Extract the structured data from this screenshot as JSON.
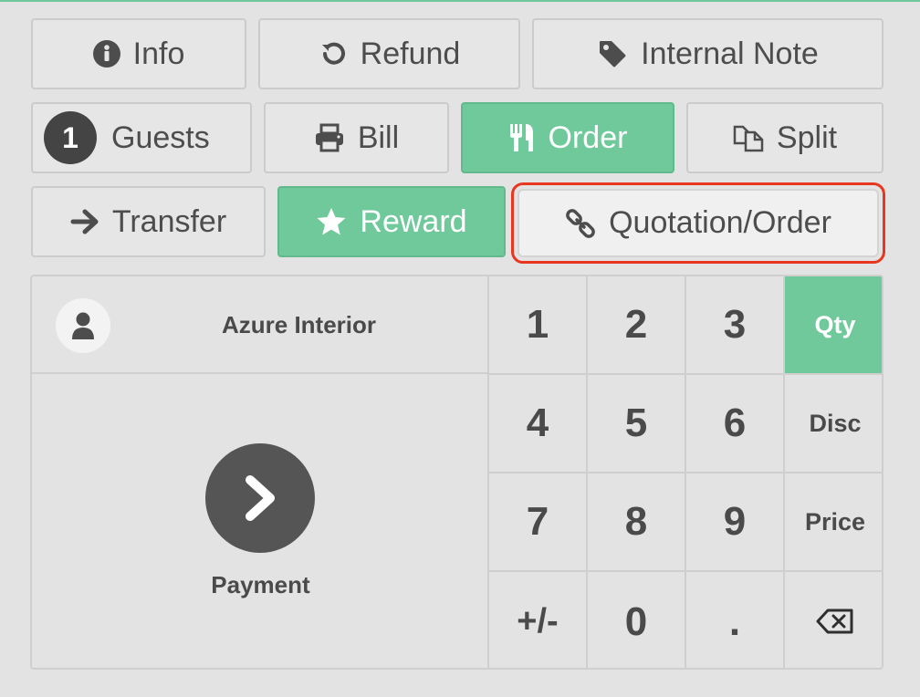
{
  "control_buttons": {
    "info": "Info",
    "refund": "Refund",
    "internal_note": "Internal Note",
    "guests_count": "1",
    "guests": "Guests",
    "bill": "Bill",
    "order": "Order",
    "split": "Split",
    "transfer": "Transfer",
    "reward": "Reward",
    "quotation_order": "Quotation/Order"
  },
  "customer": {
    "name": "Azure Interior"
  },
  "payment": {
    "label": "Payment"
  },
  "numpad": {
    "keys": [
      "1",
      "2",
      "3",
      "4",
      "5",
      "6",
      "7",
      "8",
      "9",
      "+/-",
      "0",
      "."
    ],
    "modes": {
      "qty": "Qty",
      "disc": "Disc",
      "price": "Price"
    },
    "active_mode": "Qty"
  },
  "colors": {
    "accent_green": "#70c99b",
    "highlight_outline": "#e8361f",
    "background": "#e3e3e3"
  },
  "icons": {
    "info": "info-circle-icon",
    "refund": "undo-icon",
    "internal_note": "tag-icon",
    "bill": "printer-icon",
    "order": "cutlery-icon",
    "split": "copy-icon",
    "transfer": "arrow-right-icon",
    "reward": "star-icon",
    "quotation_order": "link-icon",
    "customer": "user-icon",
    "payment": "chevron-right-icon",
    "backspace": "backspace-icon"
  }
}
